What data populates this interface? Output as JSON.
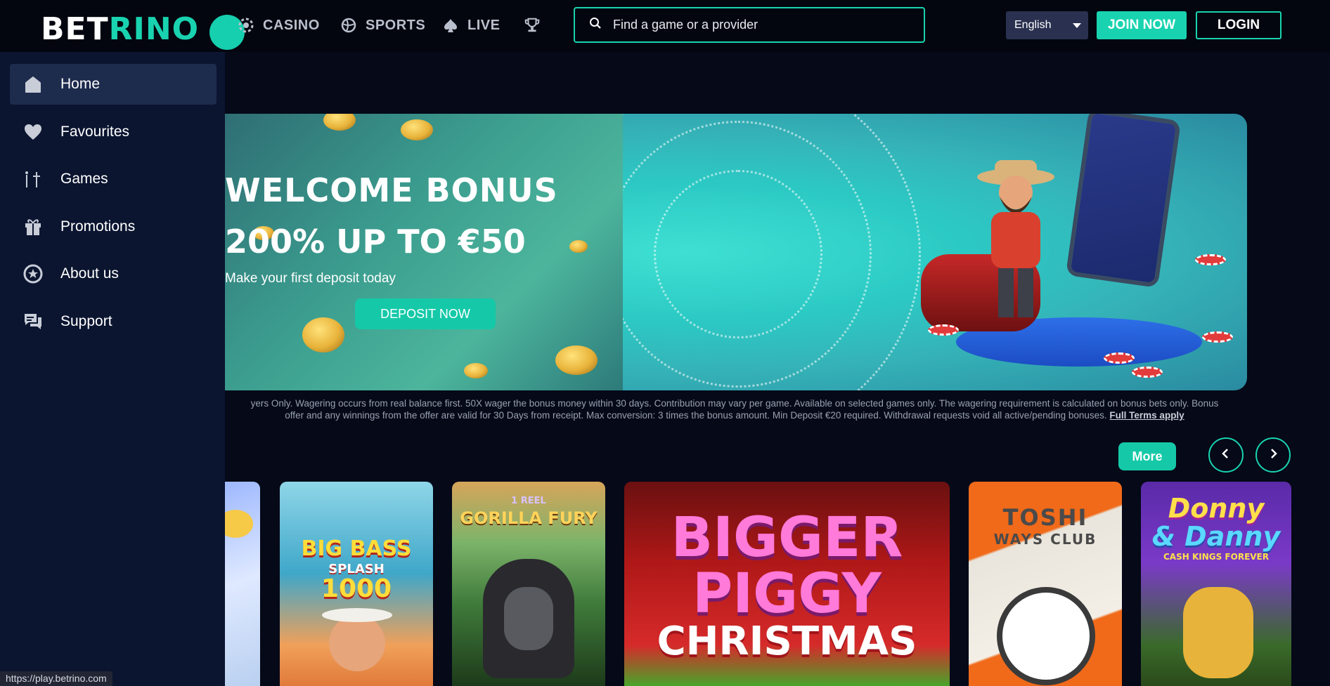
{
  "header": {
    "logo_main": "BET",
    "logo_accent": "RINO",
    "nav": [
      {
        "label": "CASINO",
        "icon": "chip-icon"
      },
      {
        "label": "SPORTS",
        "icon": "ball-icon"
      },
      {
        "label": "LIVE",
        "icon": "spade-icon"
      },
      {
        "label": "",
        "icon": "trophy-icon"
      }
    ],
    "search_placeholder": "Find a game or a provider",
    "language": "English",
    "join_label": "JOIN NOW",
    "login_label": "LOGIN"
  },
  "sidebar": {
    "items": [
      {
        "label": "Home",
        "icon": "home-icon",
        "active": true
      },
      {
        "label": "Favourites",
        "icon": "heart-icon"
      },
      {
        "label": "Games",
        "icon": "games-icon"
      },
      {
        "label": "Promotions",
        "icon": "gift-icon"
      },
      {
        "label": "About us",
        "icon": "star-badge-icon"
      },
      {
        "label": "Support",
        "icon": "chat-icon"
      }
    ]
  },
  "banner": {
    "title": "WELCOME BONUS",
    "subtitle": "200% UP TO €50",
    "tagline": "Make your first deposit today",
    "cta": "DEPOSIT NOW"
  },
  "terms": {
    "line1": "yers Only. Wagering occurs from real balance first. 50X wager the bonus money within 30 days. Contribution may vary per game. Available on selected games only. The wagering requirement is calculated on bonus bets only. Bonus",
    "line2": "offer and any winnings from the offer are valid for 30 Days from receipt. Max conversion: 3 times the bonus amount. Min Deposit €20 required. Withdrawal requests void all active/pending bonuses.",
    "link": "Full Terms apply"
  },
  "carousel": {
    "more_label": "More"
  },
  "games": [
    {
      "title": "",
      "name": "partial-frozen-game"
    },
    {
      "title": "BIG BASS SPLASH 1000",
      "line1": "BIG BASS",
      "line2": "SPLASH",
      "line3": "1000"
    },
    {
      "title": "GORILLA FURY",
      "badge": "1 REEL",
      "line1": "GORILLA FURY"
    },
    {
      "title": "BIGGER PIGGY CHRISTMAS",
      "line1": "BIGGER",
      "line2": "PIGGY",
      "line3": "CHRISTMAS"
    },
    {
      "title": "TOSHI WAYS CLUB",
      "line1": "TOSHI",
      "line2": "WAYS CLUB"
    },
    {
      "title": "Donny & Danny CASH KINGS FOREVER",
      "line1": "Donny",
      "line2": "& Danny",
      "line3": "CASH KINGS FOREVER"
    }
  ],
  "status_url": "https://play.betrino.com",
  "colors": {
    "accent": "#19d3b0",
    "sidebar_bg": "#0b1530",
    "page_bg": "#050918",
    "active_item_bg": "#1d2b4d"
  }
}
